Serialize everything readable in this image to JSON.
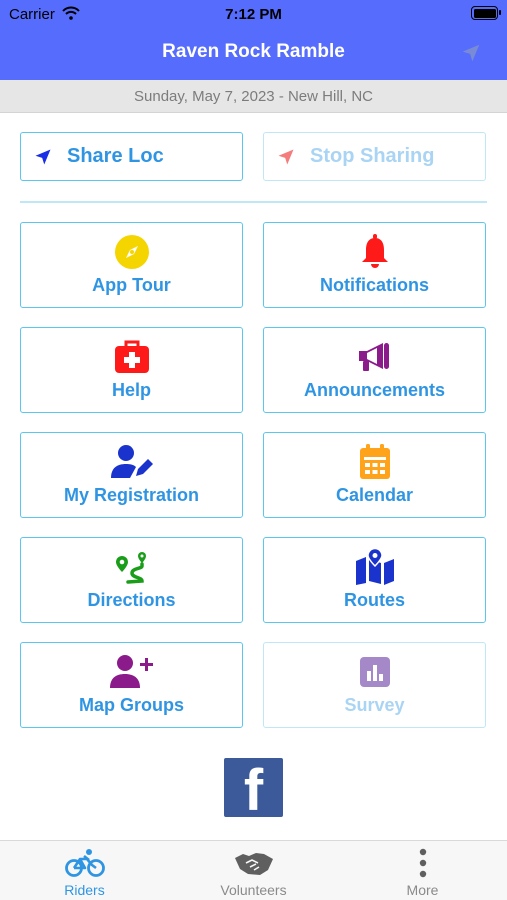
{
  "status_bar": {
    "carrier": "Carrier",
    "time": "7:12 PM",
    "battery_level": 1.0
  },
  "nav": {
    "title": "Raven Rock Ramble",
    "location_icon": "location-arrow-icon"
  },
  "date_line": "Sunday, May 7, 2023 - New Hill, NC",
  "share": {
    "share_label": "Share Loc",
    "stop_label": "Stop Sharing",
    "share_icon": "location-arrow-icon",
    "stop_icon": "location-arrow-icon"
  },
  "tiles": [
    {
      "label": "App Tour",
      "icon": "compass-icon",
      "color": "#f5d500"
    },
    {
      "label": "Notifications",
      "icon": "bell-icon",
      "color": "#ff1a1a"
    },
    {
      "label": "Help",
      "icon": "first-aid-kit-icon",
      "color": "#ff1a1a"
    },
    {
      "label": "Announcements",
      "icon": "megaphone-icon",
      "color": "#8b1a8b"
    },
    {
      "label": "My Registration",
      "icon": "user-edit-icon",
      "color": "#1a33cc"
    },
    {
      "label": "Calendar",
      "icon": "calendar-icon",
      "color": "#ffa41a"
    },
    {
      "label": "Directions",
      "icon": "route-icon",
      "color": "#1a9e1a"
    },
    {
      "label": "Routes",
      "icon": "map-icon",
      "color": "#1a33cc"
    },
    {
      "label": "Map Groups",
      "icon": "user-plus-icon",
      "color": "#8b1a8b"
    },
    {
      "label": "Survey",
      "icon": "bar-chart-icon",
      "color": "#a488c8"
    }
  ],
  "social": {
    "icon": "facebook-icon",
    "color": "#3c5a99"
  },
  "tabs": [
    {
      "label": "Riders",
      "icon": "bicycle-icon",
      "active": true
    },
    {
      "label": "Volunteers",
      "icon": "handshake-icon",
      "active": false
    },
    {
      "label": "More",
      "icon": "more-vertical-icon",
      "active": false
    }
  ],
  "colors": {
    "header": "#566cfc",
    "accent": "#2f95e3",
    "border": "#5bc6ee",
    "disabled": "#a9d4f4"
  }
}
